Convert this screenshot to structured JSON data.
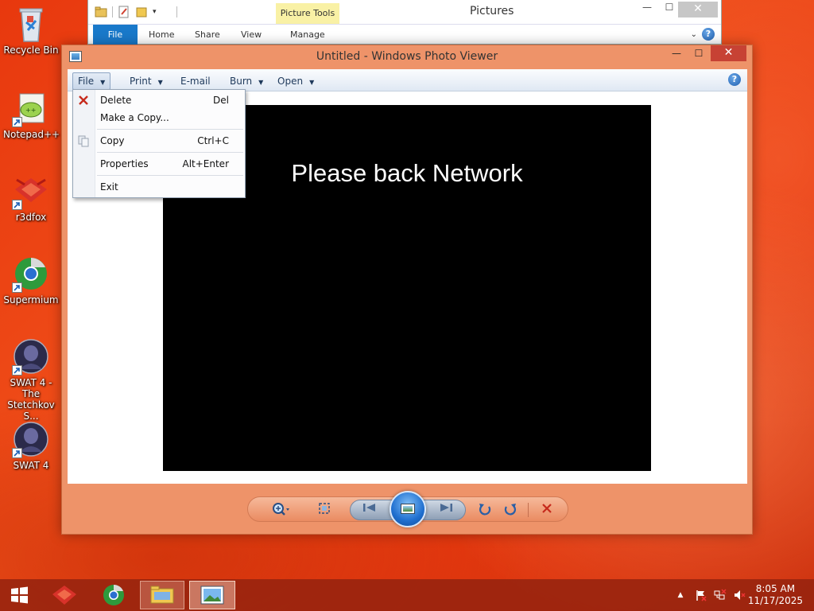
{
  "desktop": {
    "icons": [
      {
        "label": "Recycle Bin"
      },
      {
        "label": "Notepad++"
      },
      {
        "label": "r3dfox"
      },
      {
        "label": "Supermium"
      },
      {
        "label": "SWAT 4 - The Stetchkov S..."
      },
      {
        "label": "SWAT 4"
      }
    ]
  },
  "explorer": {
    "title": "Pictures",
    "contextual_tab": "Picture Tools",
    "tabs": [
      "File",
      "Home",
      "Share",
      "View",
      "Manage"
    ]
  },
  "viewer": {
    "title": "Untitled - Windows Photo Viewer",
    "menu": [
      "File",
      "Print",
      "E-mail",
      "Burn",
      "Open"
    ],
    "photo_text": "Please back Network",
    "accent": "#c74234"
  },
  "file_menu": {
    "items": [
      {
        "label": "Delete",
        "shortcut": "Del",
        "icon": "delete-x-icon"
      },
      {
        "label": "Make a Copy...",
        "shortcut": ""
      },
      {
        "label": "Copy",
        "shortcut": "Ctrl+C",
        "icon": "copy-icon"
      },
      {
        "label": "Properties",
        "shortcut": "Alt+Enter"
      },
      {
        "label": "Exit",
        "shortcut": ""
      }
    ]
  },
  "controls": {
    "icons": [
      "zoom-icon",
      "actual-size-icon",
      "previous-icon",
      "slideshow-icon",
      "next-icon",
      "rotate-ccw-icon",
      "rotate-cw-icon",
      "delete-icon"
    ]
  },
  "taskbar": {
    "time": "8:05 AM",
    "date": "11/17/2025",
    "color": "#96230f"
  }
}
